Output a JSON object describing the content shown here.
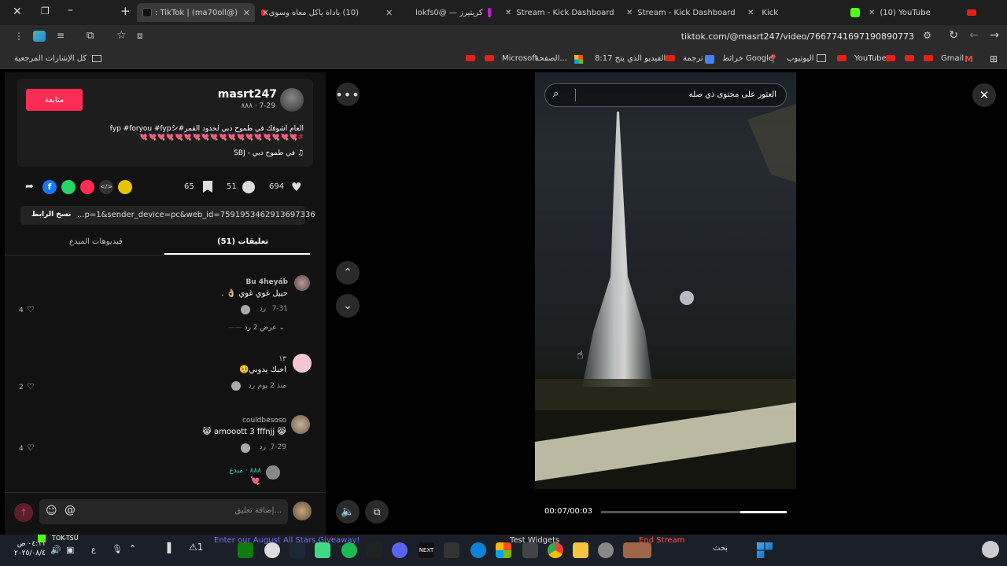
{
  "tabs": [
    {
      "label": "(@ma70oll) | TikTok :",
      "active": true
    },
    {
      "label": "(10) باداة ياكل معاه وسوى"
    },
    {
      "label": "كريتيرز — @lokfs0"
    },
    {
      "label": "Stream - Kick Dashboard"
    },
    {
      "label": "Stream - Kick Dashboard"
    },
    {
      "label": "Kick"
    },
    {
      "label": "(10) YouTube"
    }
  ],
  "address": {
    "url": "tiktok.com/@masrt247/video/7667741697190890773"
  },
  "bookmarks": {
    "all": "كل الإشارات المرجعية",
    "items": [
      "Gmail",
      "YouTube",
      "اليوتيوب",
      "خرائط Google",
      "ترجمة",
      "8:17 الفيديو الذي يتح...",
      "الصفحة...",
      "Microsoft"
    ]
  },
  "post": {
    "username": "masrt247",
    "subline": "٨٨٨ · 7-29",
    "follow": "متابعة",
    "caption": "العام اشوفك في طموح دبي لحدود القمر#fyp #foryou #fypシ",
    "caption2": "#💘💘💘💘💘💘💘💘💘💘💘💘💘💘💘💘💘💘",
    "music": "♫ في طموح دبي - SBJ",
    "likes": "694",
    "comments": "51",
    "saves": "65",
    "link": "...p=1&sender_device=pc&web_id=7591953462913697336",
    "copy": "نسخ الرابط"
  },
  "tabs_panel": {
    "comments": "(51) تعليقات",
    "videos": "فيديوهات المبدع"
  },
  "comments": [
    {
      "user": "Bu 4heyáb",
      "text": "حبيل غوي غوي 👌🏼 .",
      "date": "7-31",
      "reply": "رد",
      "likes": "4",
      "more": "عرض 2 رد"
    },
    {
      "user": "١٣",
      "text": "احبك يدوبي🥺",
      "date": "منذ 2 يوم",
      "reply": "رد",
      "likes": "2"
    },
    {
      "user": "couldbesoso",
      "text": "😹 amooott 3 fffnjj 😹",
      "date": "7-29",
      "reply": "رد",
      "likes": "4"
    },
    {
      "user": "٨٨٨ · مبدع",
      "text": "💘"
    }
  ],
  "input": {
    "placeholder": "إضافة تعليق..."
  },
  "video": {
    "search_placeholder": "العثور على محتوى ذي صلة",
    "time": "00:07/00:03",
    "progress": 0.25
  },
  "taskbar": {
    "time": "٠٤:١١ ص",
    "date": "٢٠٢٥/٠٨/٤",
    "ticker": "Enter our August All Stars Giveaway!",
    "test_widgets": "Test Widgets",
    "end_stream": "End Stream",
    "search": "بحث",
    "tok": "TOK-TSU",
    "lang": "ع"
  },
  "colors": {
    "accent": "#fe2c55",
    "link": "#6ea8ff"
  }
}
